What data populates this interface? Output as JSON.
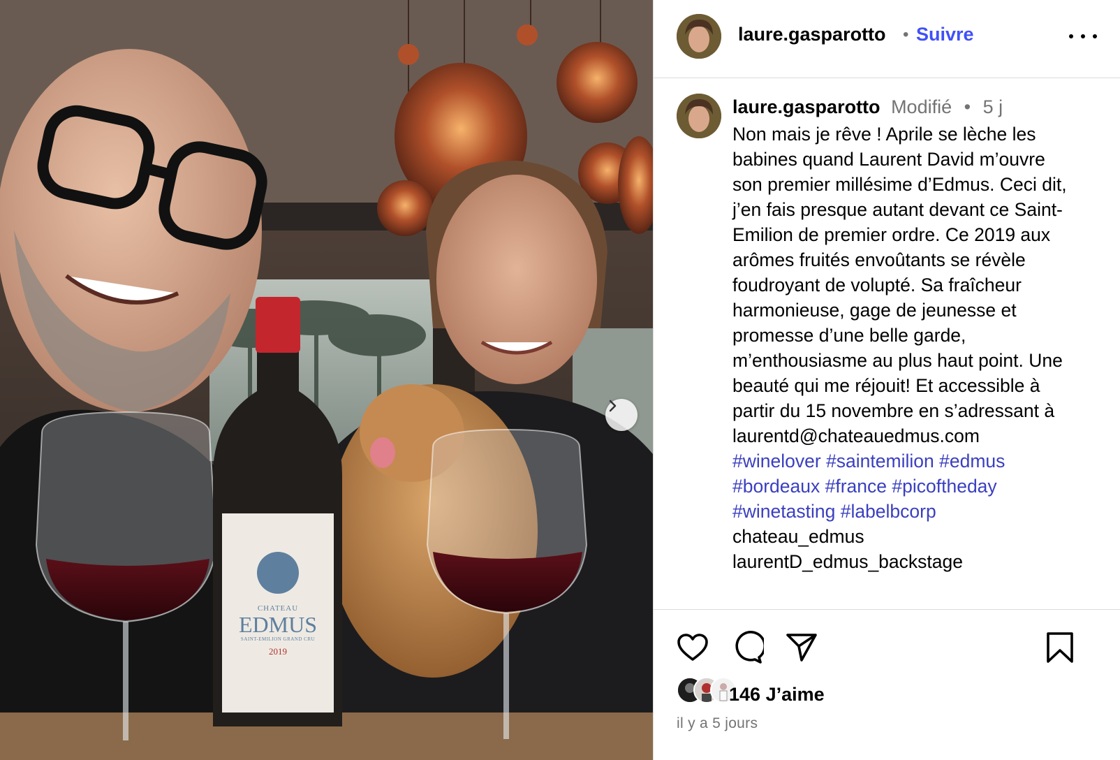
{
  "colors": {
    "link_blue": "#4150f7",
    "hashtag_blue": "#3a3fbf",
    "muted": "#737373",
    "divider": "#dbdbdb"
  },
  "photo": {
    "bottle_label": {
      "line1": "CHATEAU",
      "line2": "EDMUS",
      "line3": "SAINT-EMILION GRAND CRU",
      "vintage": "2019"
    },
    "next_icon": "chevron-right-icon"
  },
  "header": {
    "username": "laure.gasparotto",
    "separator": "•",
    "follow_label": "Suivre",
    "more_icon": "more-options-icon"
  },
  "caption": {
    "username": "laure.gasparotto",
    "edited": "Modifié",
    "separator": "•",
    "time": "5 j",
    "lines": [
      "Non mais je rêve ! Aprile se lèche les",
      "babines quand Laurent David m’ouvre",
      "son premier millésime d’Edmus. Ceci dit,",
      "j’en fais presque autant devant ce Saint-",
      "Emilion de premier ordre. Ce 2019 aux",
      "arômes fruités envoûtants se révèle",
      "foudroyant de volupté. Sa fraîcheur",
      "harmonieuse, gage de jeunesse et",
      "promesse d’une belle garde,",
      "m’enthousiasme au plus haut point. Une",
      "beauté qui me réjouit! Et accessible à",
      "partir du 15 novembre en s’adressant à",
      "laurentd@chateauedmus.com"
    ],
    "hashtags": {
      "winelover": "#winelover",
      "saintemilion": "#saintemilion",
      "edmus": "#edmus",
      "bordeaux": "#bordeaux",
      "france": "#france",
      "picoftheday": "#picoftheday",
      "winetasting": "#winetasting",
      "labelbcorp": "#labelbcorp"
    },
    "mentions": [
      "chateau_edmus",
      "laurentD_edmus_backstage"
    ]
  },
  "actions": {
    "like_icon": "heart-icon",
    "comment_icon": "comment-icon",
    "share_icon": "share-icon",
    "save_icon": "bookmark-icon",
    "likes_count": "146",
    "likes_label": "J’aime",
    "time_ago": "il y a 5 jours"
  }
}
